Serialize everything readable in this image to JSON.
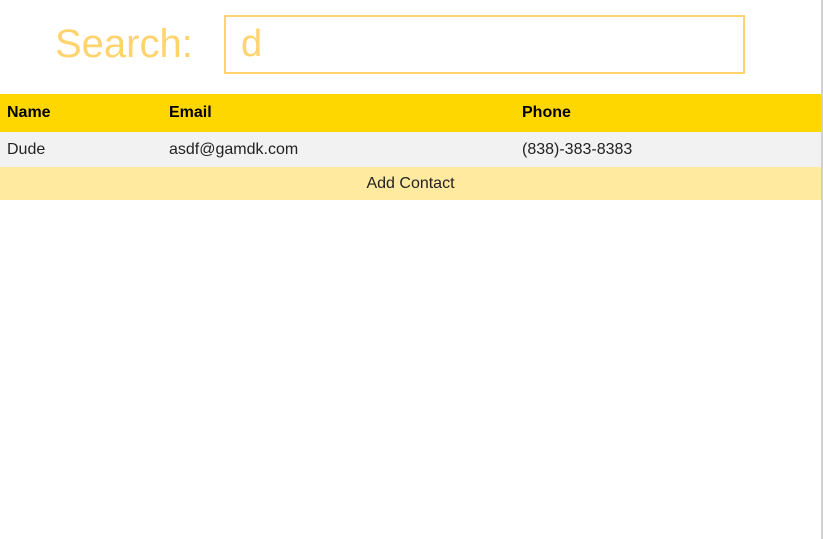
{
  "search": {
    "label": "Search:",
    "value": "d",
    "placeholder": ""
  },
  "table": {
    "headers": {
      "name": "Name",
      "email": "Email",
      "phone": "Phone"
    },
    "rows": [
      {
        "name": "Dude",
        "email": "asdf@gamdk.com",
        "phone": "(838)-383-8383"
      }
    ],
    "add_label": "Add Contact"
  },
  "colors": {
    "header_bg": "#ffd700",
    "search_accent": "#ffd36e",
    "row_bg": "#f2f2f2",
    "add_row_bg": "#ffeaa0"
  }
}
